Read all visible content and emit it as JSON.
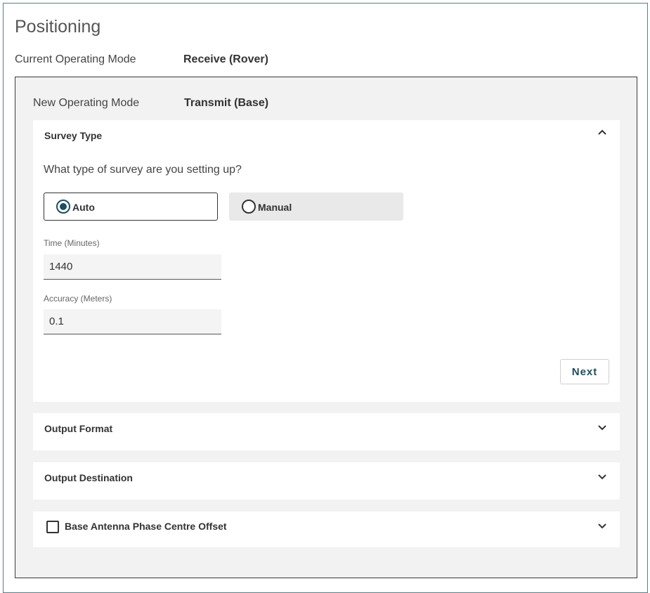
{
  "page": {
    "title": "Positioning",
    "current_mode_label": "Current Operating Mode",
    "current_mode_value": "Receive (Rover)"
  },
  "panel": {
    "new_mode_label": "New Operating Mode",
    "new_mode_value": "Transmit (Base)"
  },
  "survey_type": {
    "title": "Survey Type",
    "expanded": true,
    "question": "What type of survey are you setting up?",
    "options": [
      {
        "label": "Auto",
        "selected": true
      },
      {
        "label": "Manual",
        "selected": false
      }
    ],
    "time": {
      "label": "Time (Minutes)",
      "value": "1440"
    },
    "accuracy": {
      "label": "Accuracy (Meters)",
      "value": "0.1"
    },
    "next_label": "Next"
  },
  "output_format": {
    "title": "Output Format",
    "expanded": false
  },
  "output_destination": {
    "title": "Output Destination",
    "expanded": false
  },
  "antenna_offset": {
    "title": "Base Antenna Phase Centre Offset",
    "checked": false,
    "expanded": false
  },
  "colors": {
    "accent": "#1f4e5e",
    "panel_bg": "#f2f2f2",
    "border": "#5b7c86"
  },
  "icons": {
    "expanded": "chevron-up-icon",
    "collapsed": "chevron-down-icon"
  }
}
